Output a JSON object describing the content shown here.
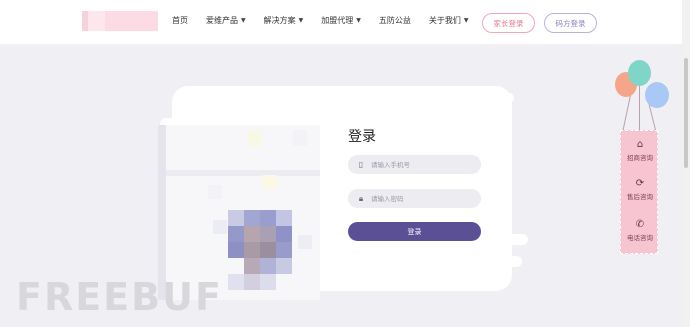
{
  "header": {
    "nav": [
      {
        "label": "首页",
        "dropdown": false
      },
      {
        "label": "爱维产品",
        "dropdown": true
      },
      {
        "label": "解决方案",
        "dropdown": true
      },
      {
        "label": "加盟代理",
        "dropdown": true
      },
      {
        "label": "五防公益",
        "dropdown": false
      },
      {
        "label": "关于我们",
        "dropdown": true
      }
    ],
    "parent_login": "家长登录",
    "code_login": "码方登录"
  },
  "login": {
    "title": "登录",
    "phone_placeholder": "请输入手机号",
    "password_placeholder": "请输入密码",
    "submit_label": "登录"
  },
  "side": {
    "items": [
      {
        "label": "招商咨询",
        "icon": "home-icon"
      },
      {
        "label": "售后咨询",
        "icon": "refresh-icon"
      },
      {
        "label": "电话咨询",
        "icon": "phone-icon"
      }
    ],
    "balloon_colors": [
      "#f4a58a",
      "#7fd6c8",
      "#a9c8f5"
    ]
  },
  "watermark": "FREEBUF"
}
